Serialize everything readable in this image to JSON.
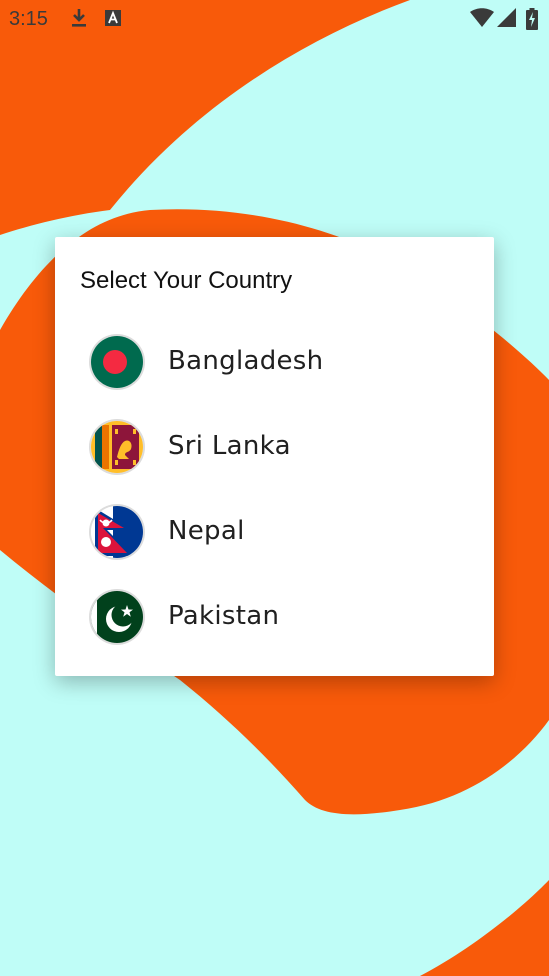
{
  "status_bar": {
    "time": "3:15",
    "icons": [
      "download-icon",
      "app-notification-icon",
      "wifi-icon",
      "signal-icon",
      "battery-icon"
    ]
  },
  "dialog": {
    "title": "Select Your Country",
    "countries": [
      {
        "name": "Bangladesh",
        "flag": "bangladesh-flag-icon"
      },
      {
        "name": "Sri Lanka",
        "flag": "sri-lanka-flag-icon"
      },
      {
        "name": "Nepal",
        "flag": "nepal-flag-icon"
      },
      {
        "name": "Pakistan",
        "flag": "pakistan-flag-icon"
      }
    ]
  },
  "colors": {
    "background": "#bffdf7",
    "accent_orange": "#f85a0a",
    "dialog_bg": "#ffffff"
  }
}
